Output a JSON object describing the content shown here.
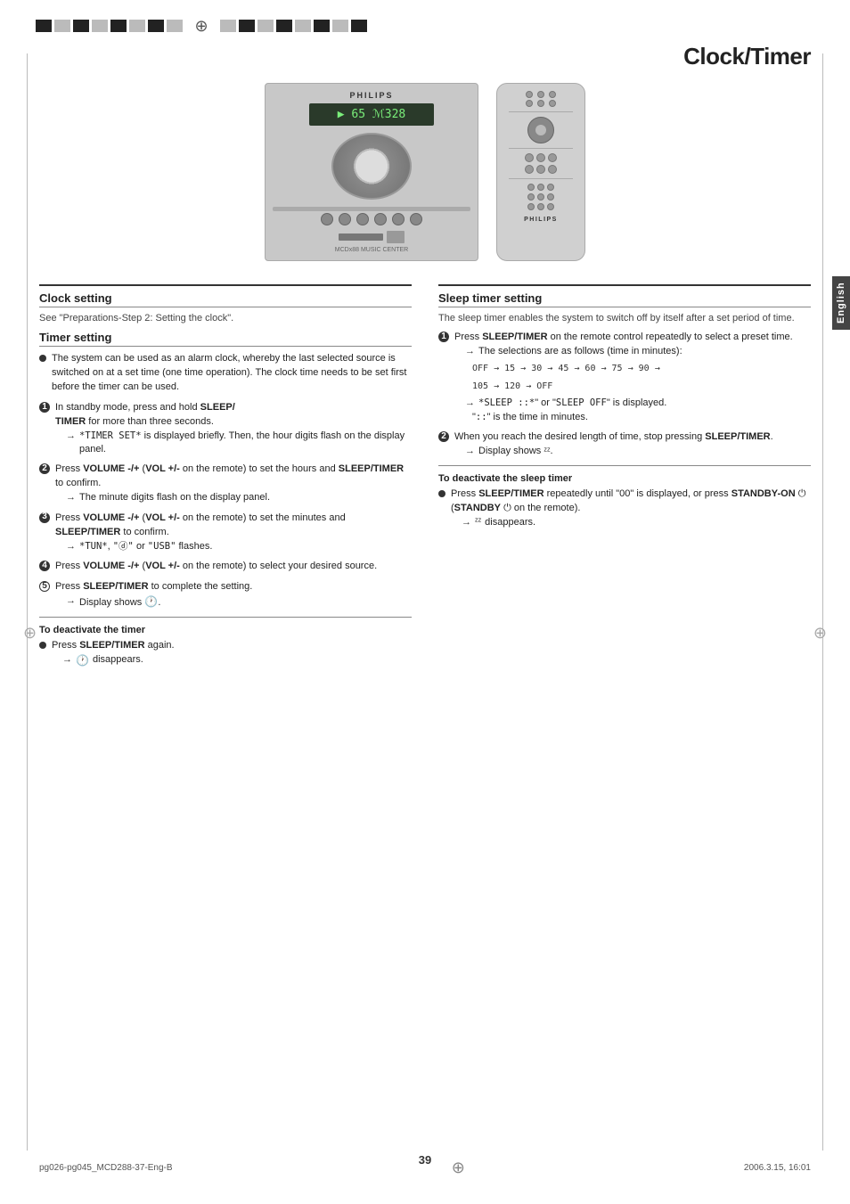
{
  "page": {
    "title": "Clock/Timer",
    "page_number": "39",
    "language_tab": "English",
    "footer_left": "pg026-pg045_MCD288-37-Eng-B",
    "footer_center": "39",
    "footer_right": "2006.3.15, 16:01"
  },
  "stereo": {
    "brand": "PHILIPS",
    "display": "▶ 65 ℳ328"
  },
  "remote": {
    "brand": "PHILIPS"
  },
  "clock_setting": {
    "title": "Clock setting",
    "subtitle": "See \"Preparations-Step 2: Setting the clock\"."
  },
  "timer_setting": {
    "title": "Timer setting",
    "intro": "The system can be used as an alarm clock, whereby the last selected source is switched on at a set time (one time operation). The clock time needs to be set first before the timer can be used.",
    "steps": [
      {
        "num": "1",
        "text": "In standby mode, press and hold SLEEP/TIMER for more than three seconds.",
        "bold_parts": [
          "SLEEP/TIMER"
        ],
        "arrow": "*TIMER SET* is displayed briefly. Then, the hour digits flash on the display panel.",
        "arrow_prefix": "→"
      },
      {
        "num": "2",
        "text": "Press VOLUME -/+ (VOL +/- on the remote) to set the hours and SLEEP/TIMER to confirm.",
        "bold_parts": [
          "VOLUME -/+",
          "VOL +/-",
          "SLEEP/TIMER"
        ],
        "arrow": "The minute digits flash on the display panel.",
        "arrow_prefix": "→"
      },
      {
        "num": "3",
        "text": "Press VOLUME -/+ (VOL +/- on the remote) to set the minutes and SLEEP/TIMER to confirm.",
        "bold_parts": [
          "VOLUME -/+",
          "VOL +/-",
          "SLEEP/TIMER"
        ],
        "arrow": "\"TUN\", \"ⓓ\" or \"USB\" flashes.",
        "arrow_prefix": "→"
      },
      {
        "num": "4",
        "text": "Press VOLUME -/+ (VOL +/- on the remote) to select your desired source.",
        "bold_parts": [
          "VOLUME -/+",
          "VOL +/-"
        ]
      },
      {
        "num": "5",
        "text": "Press SLEEP/TIMER to complete the setting.",
        "bold_parts": [
          "SLEEP/TIMER"
        ],
        "arrow": "Display shows",
        "arrow_icon": "clock-icon",
        "arrow_prefix": "→"
      }
    ],
    "deactivate_timer": {
      "subtitle": "To deactivate the timer",
      "text": "Press SLEEP/TIMER again.",
      "bold_parts": [
        "SLEEP/TIMER"
      ],
      "arrow": "disappears.",
      "arrow_prefix": "→"
    }
  },
  "sleep_timer_setting": {
    "title": "Sleep timer setting",
    "intro": "The sleep timer enables the system to switch off by itself after a set period of time.",
    "steps": [
      {
        "num": "1",
        "text": "Press SLEEP/TIMER on the remote control repeatedly to select a preset time.",
        "bold_parts": [
          "SLEEP/TIMER"
        ],
        "arrow1": "The selections are as follows (time in minutes):",
        "time_flow_1": "OFF → 15 → 30 → 45 → 60 → 75 → 90 →",
        "time_flow_2": "105 → 120 → OFF",
        "arrow2": "→ *SLEEP ::*\" or \"SLEEP OFF\" is displayed.",
        "arrow3": "\"::\" is the time in minutes."
      },
      {
        "num": "2",
        "text": "When you reach the desired length of time, stop pressing SLEEP/TIMER.",
        "bold_parts": [
          "SLEEP/TIMER"
        ],
        "arrow": "Display shows",
        "arrow_suffix": "ᶻᶻ",
        "arrow_prefix": "→"
      }
    ],
    "deactivate": {
      "subtitle": "To deactivate the sleep timer",
      "bullet_text": "Press SLEEP/TIMER repeatedly until \"00\" is displayed, or press STANDBY-ON",
      "bold_parts": [
        "SLEEP/TIMER",
        "STANDBY-ON"
      ],
      "sub_text": "(STANDBY on the remote).",
      "sub_bold": "STANDBY",
      "arrow": "disappears.",
      "arrow_prefix": "→",
      "arrow_icon": "zz-icon"
    }
  }
}
